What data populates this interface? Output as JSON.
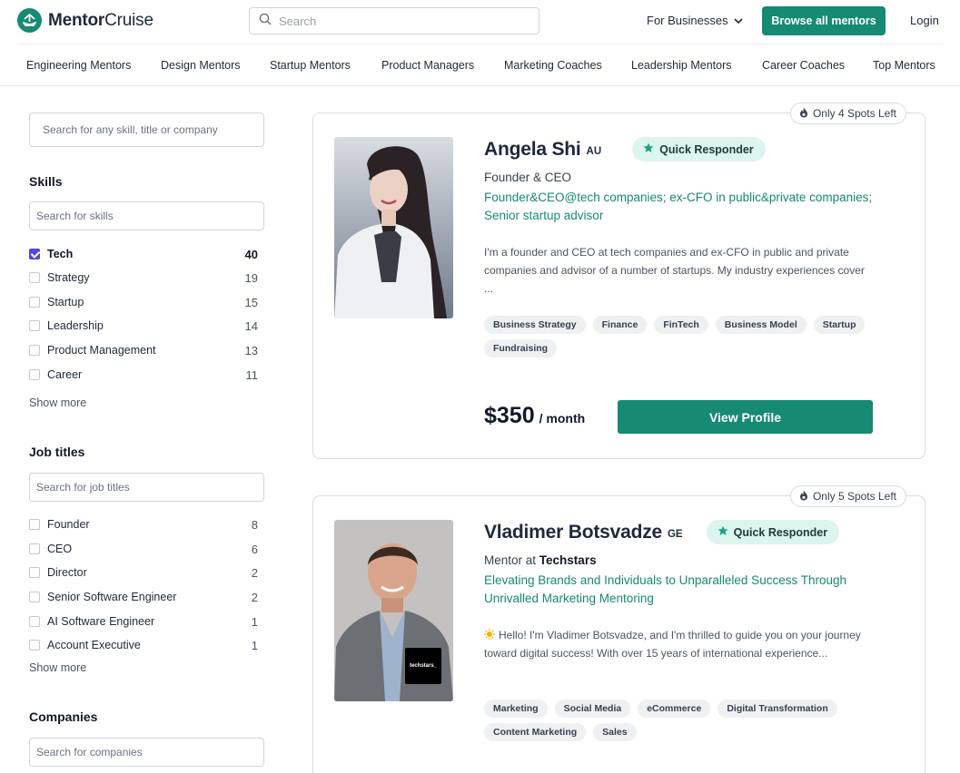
{
  "header": {
    "brand_bold": "Mentor",
    "brand_regular": "Cruise",
    "search_placeholder": "Search",
    "for_businesses": "For Businesses",
    "browse_label": "Browse all mentors",
    "login_label": "Login"
  },
  "categories": [
    "Engineering Mentors",
    "Design Mentors",
    "Startup Mentors",
    "Product Managers",
    "Marketing Coaches",
    "Leadership Mentors",
    "Career Coaches",
    "Top Mentors"
  ],
  "sidebar": {
    "main_search_placeholder": "Search for any skill, title or company",
    "skills": {
      "title": "Skills",
      "placeholder": "Search for skills",
      "items": [
        {
          "label": "Tech",
          "count": "40",
          "checked": true
        },
        {
          "label": "Strategy",
          "count": "19",
          "checked": false
        },
        {
          "label": "Startup",
          "count": "15",
          "checked": false
        },
        {
          "label": "Leadership",
          "count": "14",
          "checked": false
        },
        {
          "label": "Product Management",
          "count": "13",
          "checked": false
        },
        {
          "label": "Career",
          "count": "11",
          "checked": false
        }
      ],
      "show_more": "Show more"
    },
    "job_titles": {
      "title": "Job titles",
      "placeholder": "Search for job titles",
      "items": [
        {
          "label": "Founder",
          "count": "8"
        },
        {
          "label": "CEO",
          "count": "6"
        },
        {
          "label": "Director",
          "count": "2"
        },
        {
          "label": "Senior Software Engineer",
          "count": "2"
        },
        {
          "label": "AI Software Engineer",
          "count": "1"
        },
        {
          "label": "Account Executive",
          "count": "1"
        }
      ],
      "show_more": "Show more"
    },
    "companies": {
      "title": "Companies",
      "placeholder": "Search for companies"
    }
  },
  "mentors": [
    {
      "spots": "Only 4 Spots Left",
      "name": "Angela Shi",
      "country": "AU",
      "badge": "Quick Responder",
      "role": "Founder & CEO",
      "headline": "Founder&CEO@tech companies; ex-CFO in public&private companies; Senior startup advisor",
      "bio": "I'm a founder and CEO at tech companies and ex-CFO in public and private companies and advisor of a number of startups. My industry experiences cover ...",
      "tags": [
        "Business Strategy",
        "Finance",
        "FinTech",
        "Business Model",
        "Startup",
        "Fundraising"
      ],
      "price": "$350",
      "per": "/ month",
      "cta": "View Profile"
    },
    {
      "spots": "Only 5 Spots Left",
      "name": "Vladimer Botsvadze",
      "country": "GE",
      "badge": "Quick Responder",
      "role_prefix": "Mentor at",
      "company": "Techstars",
      "company_logo_text": "techstars_",
      "headline": "Elevating Brands and Individuals to Unparalleled Success Through Unrivalled Marketing Mentoring",
      "bio": "Hello! I'm Vladimer Botsvadze, and I'm thrilled to guide you on your journey toward digital success! With over 15 years of international experience...",
      "tags": [
        "Marketing",
        "Social Media",
        "eCommerce",
        "Digital Transformation",
        "Content Marketing",
        "Sales"
      ]
    }
  ],
  "colors": {
    "brand": "#168a73",
    "badge_bg": "#dcf5ee",
    "checkbox": "#4f46e5"
  }
}
